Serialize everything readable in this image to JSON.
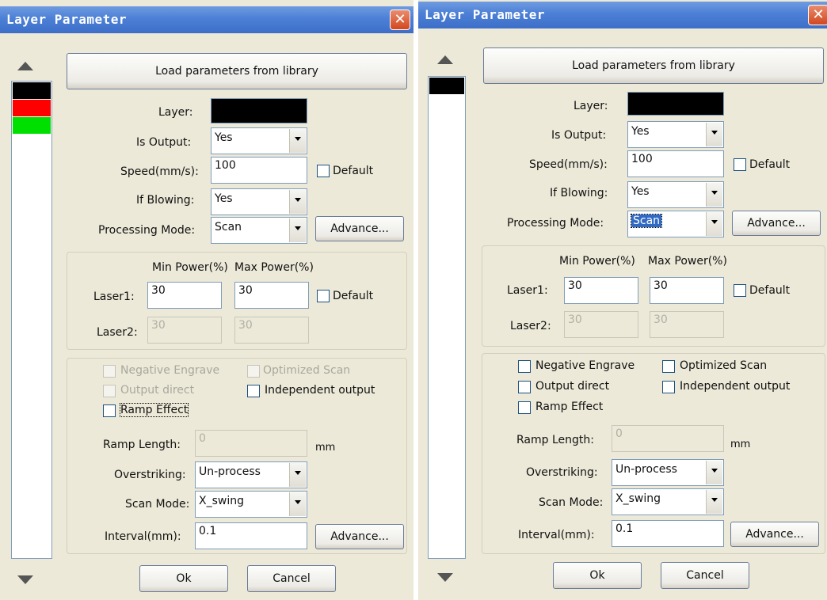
{
  "dialogs": [
    {
      "title": "Layer Parameter",
      "close_glyph": "✕",
      "layer_swatches": [
        "#000000",
        "#ff0000",
        "#00e000"
      ],
      "load_button": "Load parameters from library",
      "layer_label": "Layer:",
      "layer_color": "#000000",
      "is_output_label": "Is Output:",
      "is_output_value": "Yes",
      "speed_label": "Speed(mm/s):",
      "speed_value": "100",
      "default_label": "Default",
      "if_blowing_label": "If Blowing:",
      "if_blowing_value": "Yes",
      "processing_mode_label": "Processing Mode:",
      "processing_mode_value": "Scan",
      "advance_label": "Advance...",
      "min_power_label": "Min Power(%)",
      "max_power_label": "Max Power(%)",
      "laser1_label": "Laser1:",
      "laser1_min": "30",
      "laser1_max": "30",
      "laser2_label": "Laser2:",
      "laser2_min": "30",
      "laser2_max": "30",
      "negative_engrave": "Negative Engrave",
      "optimized_scan": "Optimized Scan",
      "output_direct": "Output direct",
      "independent_output": "Independent output",
      "ramp_effect": "Ramp Effect",
      "ramp_length_label": "Ramp Length:",
      "ramp_length_value": "0",
      "mm_unit": "mm",
      "overstriking_label": "Overstriking:",
      "overstriking_value": "Un-process",
      "scan_mode_label": "Scan Mode:",
      "scan_mode_value": "X_swing",
      "interval_label": "Interval(mm):",
      "interval_value": "0.1",
      "ok_label": "Ok",
      "cancel_label": "Cancel"
    },
    {
      "title": "Layer Parameter",
      "close_glyph": "✕",
      "layer_swatches": [
        "#000000"
      ],
      "load_button": "Load parameters from library",
      "layer_label": "Layer:",
      "layer_color": "#000000",
      "is_output_label": "Is Output:",
      "is_output_value": "Yes",
      "speed_label": "Speed(mm/s):",
      "speed_value": "100",
      "default_label": "Default",
      "if_blowing_label": "If Blowing:",
      "if_blowing_value": "Yes",
      "processing_mode_label": "Processing Mode:",
      "processing_mode_value": "Scan",
      "advance_label": "Advance...",
      "min_power_label": "Min Power(%)",
      "max_power_label": "Max Power(%)",
      "laser1_label": "Laser1:",
      "laser1_min": "30",
      "laser1_max": "30",
      "laser2_label": "Laser2:",
      "laser2_min": "30",
      "laser2_max": "30",
      "negative_engrave": "Negative Engrave",
      "optimized_scan": "Optimized Scan",
      "output_direct": "Output direct",
      "independent_output": "Independent output",
      "ramp_effect": "Ramp Effect",
      "ramp_length_label": "Ramp Length:",
      "ramp_length_value": "0",
      "mm_unit": "mm",
      "overstriking_label": "Overstriking:",
      "overstriking_value": "Un-process",
      "scan_mode_label": "Scan Mode:",
      "scan_mode_value": "X_swing",
      "interval_label": "Interval(mm):",
      "interval_value": "0.1",
      "ok_label": "Ok",
      "cancel_label": "Cancel"
    }
  ]
}
